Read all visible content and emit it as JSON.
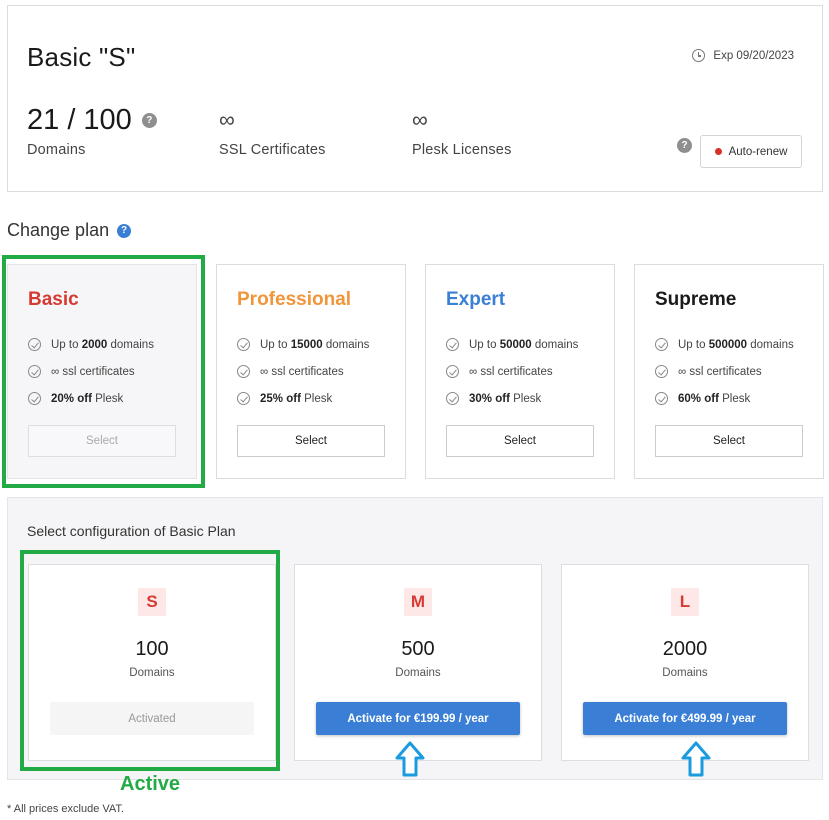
{
  "summary": {
    "title": "Basic \"S\"",
    "expiry": "Exp 09/20/2023",
    "domains_value": "21 / 100",
    "domains_label": "Domains",
    "ssl_value": "∞",
    "ssl_label": "SSL Certificates",
    "plesk_value": "∞",
    "plesk_label": "Plesk Licenses",
    "autorenew_label": "Auto-renew",
    "help_glyph": "?"
  },
  "change_plan": {
    "title": "Change plan",
    "plans": [
      {
        "name": "Basic",
        "color": "#d63a32",
        "f1_pre": "Up to ",
        "f1_b": "2000",
        "f1_post": " domains",
        "f2": "∞ ssl certificates",
        "f3_b": "20% off",
        "f3_post": " Plesk",
        "button": "Select"
      },
      {
        "name": "Professional",
        "color": "#f0953a",
        "f1_pre": "Up to ",
        "f1_b": "15000",
        "f1_post": " domains",
        "f2": "∞ ssl certificates",
        "f3_b": "25% off",
        "f3_post": " Plesk",
        "button": "Select"
      },
      {
        "name": "Expert",
        "color": "#3a7fd5",
        "f1_pre": "Up to ",
        "f1_b": "50000",
        "f1_post": " domains",
        "f2": "∞ ssl certificates",
        "f3_b": "30% off",
        "f3_post": " Plesk",
        "button": "Select"
      },
      {
        "name": "Supreme",
        "color": "#1a1a1a",
        "f1_pre": "Up to ",
        "f1_b": "500000",
        "f1_post": " domains",
        "f2": "∞ ssl certificates",
        "f3_b": "60% off",
        "f3_post": " Plesk",
        "button": "Select"
      }
    ]
  },
  "configuration": {
    "title": "Select configuration of Basic Plan",
    "options": [
      {
        "badge": "S",
        "count": "100",
        "unit": "Domains",
        "button": "Activated"
      },
      {
        "badge": "M",
        "count": "500",
        "unit": "Domains",
        "button": "Activate for €199.99 / year"
      },
      {
        "badge": "L",
        "count": "2000",
        "unit": "Domains",
        "button": "Activate for €499.99 / year"
      }
    ]
  },
  "annotation": {
    "active_label": "Active",
    "highlight_color": "#22aa44",
    "arrow_color": "#1a9be0"
  },
  "footnote": "* All prices exclude VAT."
}
